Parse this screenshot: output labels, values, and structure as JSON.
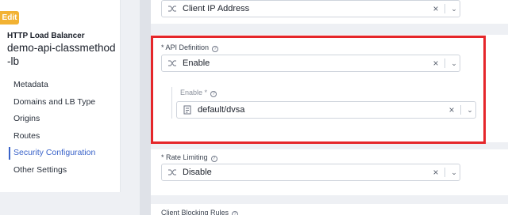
{
  "sidebar": {
    "edit_badge": "Edit",
    "resource_type": "HTTP Load Balancer",
    "resource_name": "demo-api-classmethod-lb",
    "items": [
      {
        "label": "Metadata"
      },
      {
        "label": "Domains and LB Type"
      },
      {
        "label": "Origins"
      },
      {
        "label": "Routes"
      },
      {
        "label": "Security Configuration",
        "active": true
      },
      {
        "label": "Other Settings"
      }
    ]
  },
  "fields": {
    "client_ip": {
      "value": "Client IP Address"
    },
    "api_definition": {
      "label": "* API Definition",
      "value": "Enable"
    },
    "api_enable": {
      "label": "Enable *",
      "value": "default/dvsa"
    },
    "rate_limiting": {
      "label": "* Rate Limiting",
      "value": "Disable"
    },
    "client_blocking": {
      "label": "Client Blocking Rules"
    }
  },
  "colors": {
    "accent": "#3a63c9",
    "highlight": "#e5262a",
    "edit_badge": "#f2b233"
  }
}
